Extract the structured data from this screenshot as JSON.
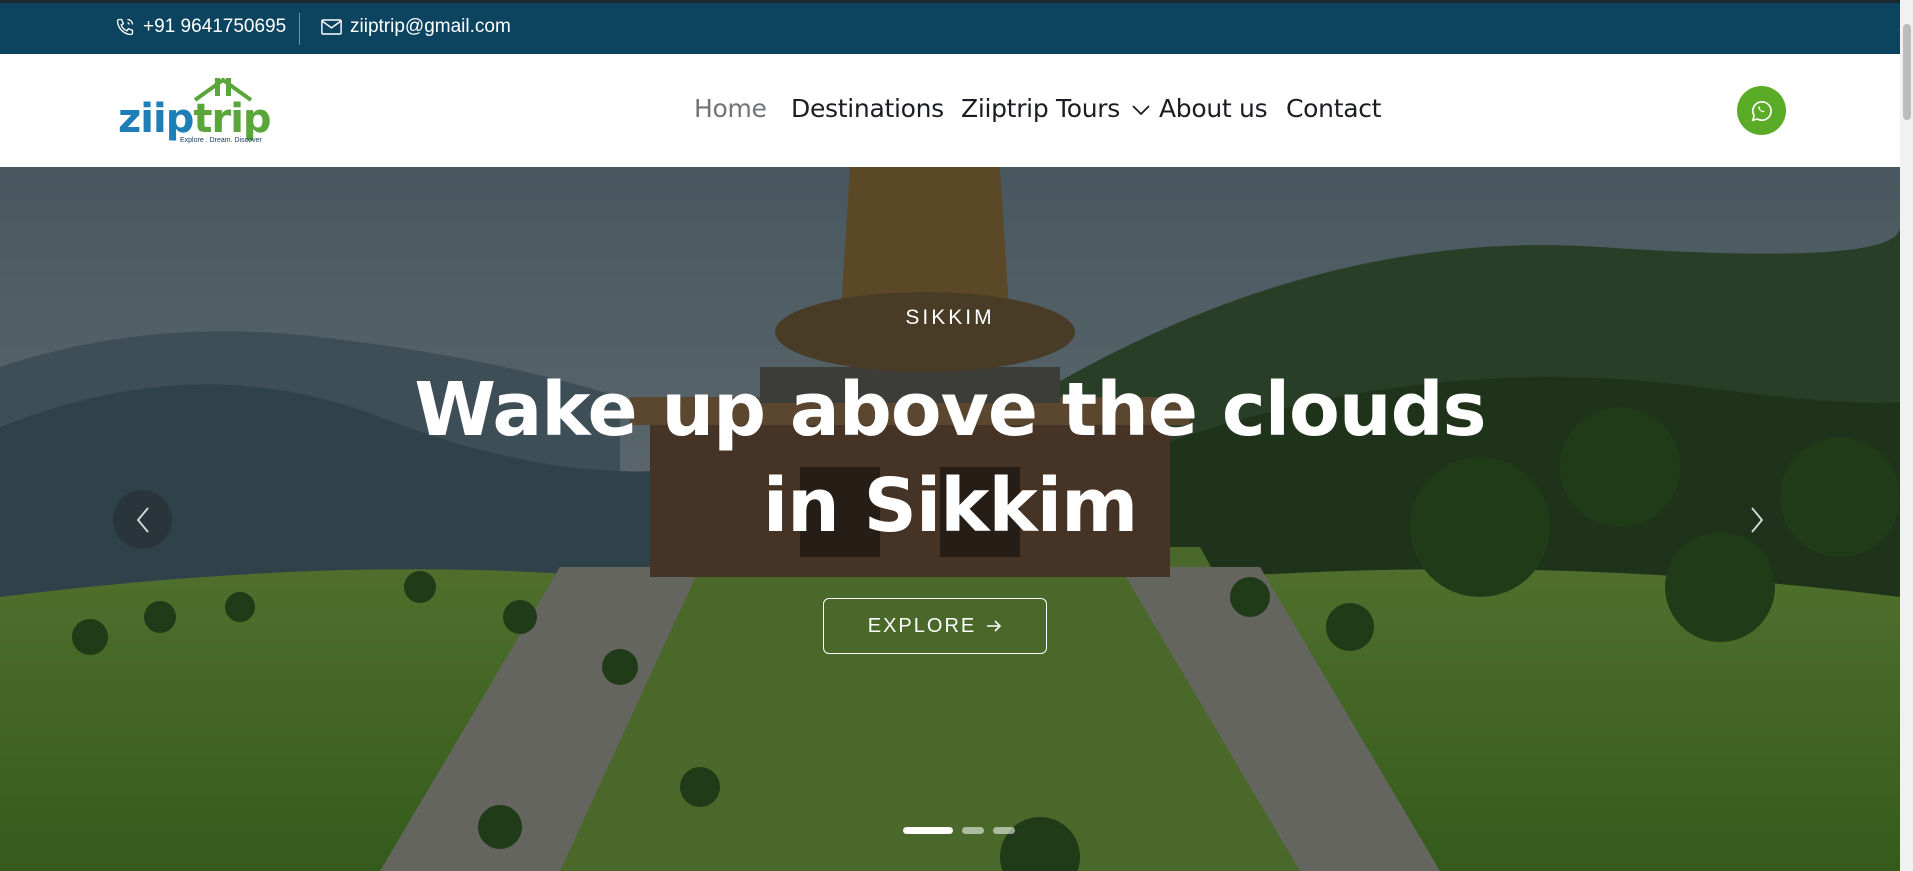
{
  "topbar": {
    "phone": "+91 9641750695",
    "email": "ziiptrip@gmail.com",
    "phone_icon": "phone-icon",
    "email_icon": "envelope-icon"
  },
  "logo": {
    "wordmark_a": "ziip",
    "wordmark_b": "trip",
    "tagline": "Explore . Dream. Discover"
  },
  "nav": {
    "items": [
      {
        "label": "Home",
        "active": true
      },
      {
        "label": "Destinations"
      },
      {
        "label": "Ziiptrip Tours",
        "has_dropdown": true
      },
      {
        "label": "About us"
      },
      {
        "label": "Contact"
      }
    ]
  },
  "whatsapp": {
    "icon": "whatsapp-icon",
    "color": "#5aab25"
  },
  "hero": {
    "kicker": "SIKKIM",
    "headline_line1": "Wake up above the clouds",
    "headline_line2": "in Sikkim",
    "cta_label": "EXPLORE",
    "cta_icon": "arrow-right-icon",
    "slides_total": 3,
    "active_slide": 1
  },
  "colors": {
    "topbar_bg": "#0c4460",
    "accent_green": "#5aab25",
    "nav_text": "#1b1d22",
    "nav_active": "#717478"
  }
}
